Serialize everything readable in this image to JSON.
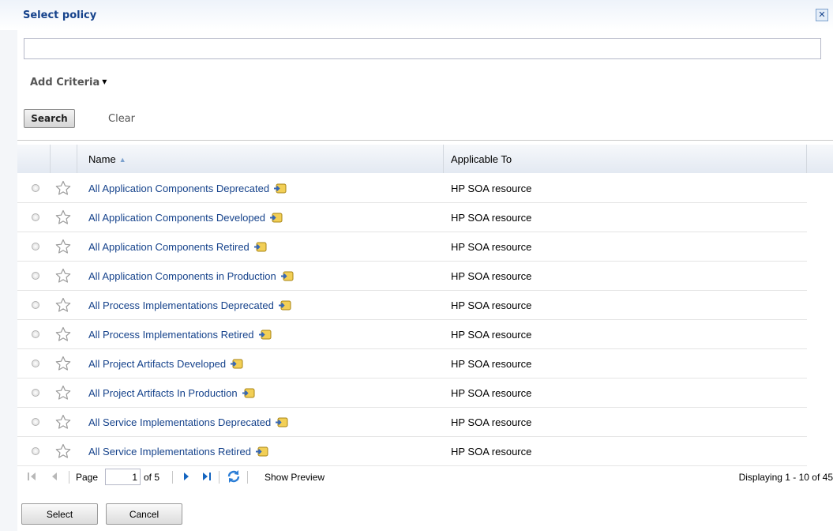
{
  "dialog": {
    "title": "Select policy",
    "close_icon": "close-icon"
  },
  "search": {
    "value": "",
    "placeholder": ""
  },
  "criteria": {
    "add_label": "Add Criteria"
  },
  "actions": {
    "search_label": "Search",
    "clear_label": "Clear"
  },
  "grid": {
    "columns": [
      {
        "key": "name",
        "label": "Name",
        "sort": "ascending"
      },
      {
        "key": "applicable_to",
        "label": "Applicable To"
      }
    ],
    "rows": [
      {
        "name": "All Application Components Deprecated",
        "applicable_to": "HP SOA resource"
      },
      {
        "name": "All Application Components Developed",
        "applicable_to": "HP SOA resource"
      },
      {
        "name": "All Application Components Retired",
        "applicable_to": "HP SOA resource"
      },
      {
        "name": "All Application Components in Production",
        "applicable_to": "HP SOA resource"
      },
      {
        "name": "All Process Implementations Deprecated",
        "applicable_to": "HP SOA resource"
      },
      {
        "name": "All Process Implementations Retired",
        "applicable_to": "HP SOA resource"
      },
      {
        "name": "All Project Artifacts Developed",
        "applicable_to": "HP SOA resource"
      },
      {
        "name": "All Project Artifacts In Production",
        "applicable_to": "HP SOA resource"
      },
      {
        "name": "All Service Implementations Deprecated",
        "applicable_to": "HP SOA resource"
      },
      {
        "name": "All Service Implementations Retired",
        "applicable_to": "HP SOA resource"
      }
    ]
  },
  "pager": {
    "page_label": "Page",
    "current_page": "1",
    "of_label": "of 5",
    "show_preview_label": "Show Preview",
    "displaying": "Displaying 1 - 10 of 45"
  },
  "footer": {
    "select_label": "Select",
    "cancel_label": "Cancel"
  },
  "colors": {
    "link": "#15428b",
    "title": "#15428b",
    "accent": "#1565c0"
  }
}
